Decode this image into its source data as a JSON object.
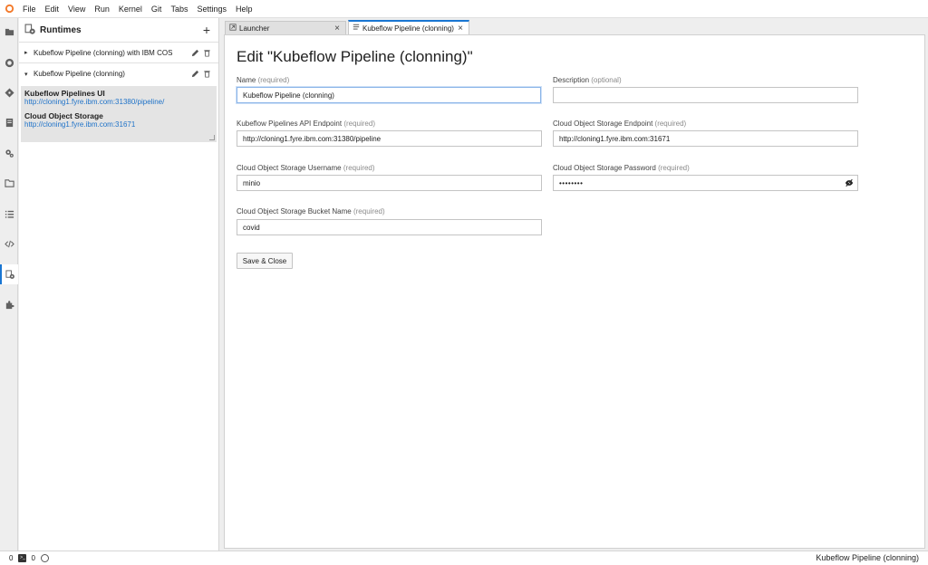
{
  "menubar": {
    "items": [
      "File",
      "Edit",
      "View",
      "Run",
      "Kernel",
      "Git",
      "Tabs",
      "Settings",
      "Help"
    ]
  },
  "activity_icons": [
    "folder-icon",
    "running-icon",
    "git-icon",
    "property-inspector-icon",
    "settings-icon",
    "tabs-icon",
    "toc-icon",
    "code-snippet-icon",
    "runtimes-icon",
    "extension-icon"
  ],
  "sidebar": {
    "title": "Runtimes",
    "add_label": "+",
    "runtimes": [
      {
        "caret": "▸",
        "name": "Kubeflow Pipeline (clonning) with IBM COS"
      },
      {
        "caret": "▾",
        "name": "Kubeflow Pipeline (clonning)"
      }
    ],
    "details": {
      "kfp_label": "Kubeflow Pipelines UI",
      "kfp_url": "http://cloning1.fyre.ibm.com:31380/pipeline/",
      "cos_label": "Cloud Object Storage",
      "cos_url": "http://cloning1.fyre.ibm.com:31671"
    }
  },
  "tabs": [
    {
      "label": "Launcher",
      "active": false
    },
    {
      "label": "Kubeflow Pipeline (clonning)",
      "active": true
    }
  ],
  "editor": {
    "title": "Edit \"Kubeflow Pipeline (clonning)\"",
    "name": {
      "label": "Name",
      "hint": "(required)",
      "value": "Kubeflow Pipeline (clonning)"
    },
    "description": {
      "label": "Description",
      "hint": "(optional)",
      "value": ""
    },
    "api_endpoint": {
      "label": "Kubeflow Pipelines API Endpoint",
      "hint": "(required)",
      "value": "http://cloning1.fyre.ibm.com:31380/pipeline"
    },
    "cos_endpoint": {
      "label": "Cloud Object Storage Endpoint",
      "hint": "(required)",
      "value": "http://cloning1.fyre.ibm.com:31671"
    },
    "cos_username": {
      "label": "Cloud Object Storage Username",
      "hint": "(required)",
      "value": "minio"
    },
    "cos_password": {
      "label": "Cloud Object Storage Password",
      "hint": "(required)",
      "value": "••••••••"
    },
    "cos_bucket": {
      "label": "Cloud Object Storage Bucket Name",
      "hint": "(required)",
      "value": "covid"
    },
    "save_label": "Save & Close"
  },
  "statusbar": {
    "terminals": "0",
    "kernels": "0",
    "right_text": "Kubeflow Pipeline (clonning)"
  },
  "colors": {
    "accent": "#1976d2",
    "link": "#1e72c8"
  }
}
